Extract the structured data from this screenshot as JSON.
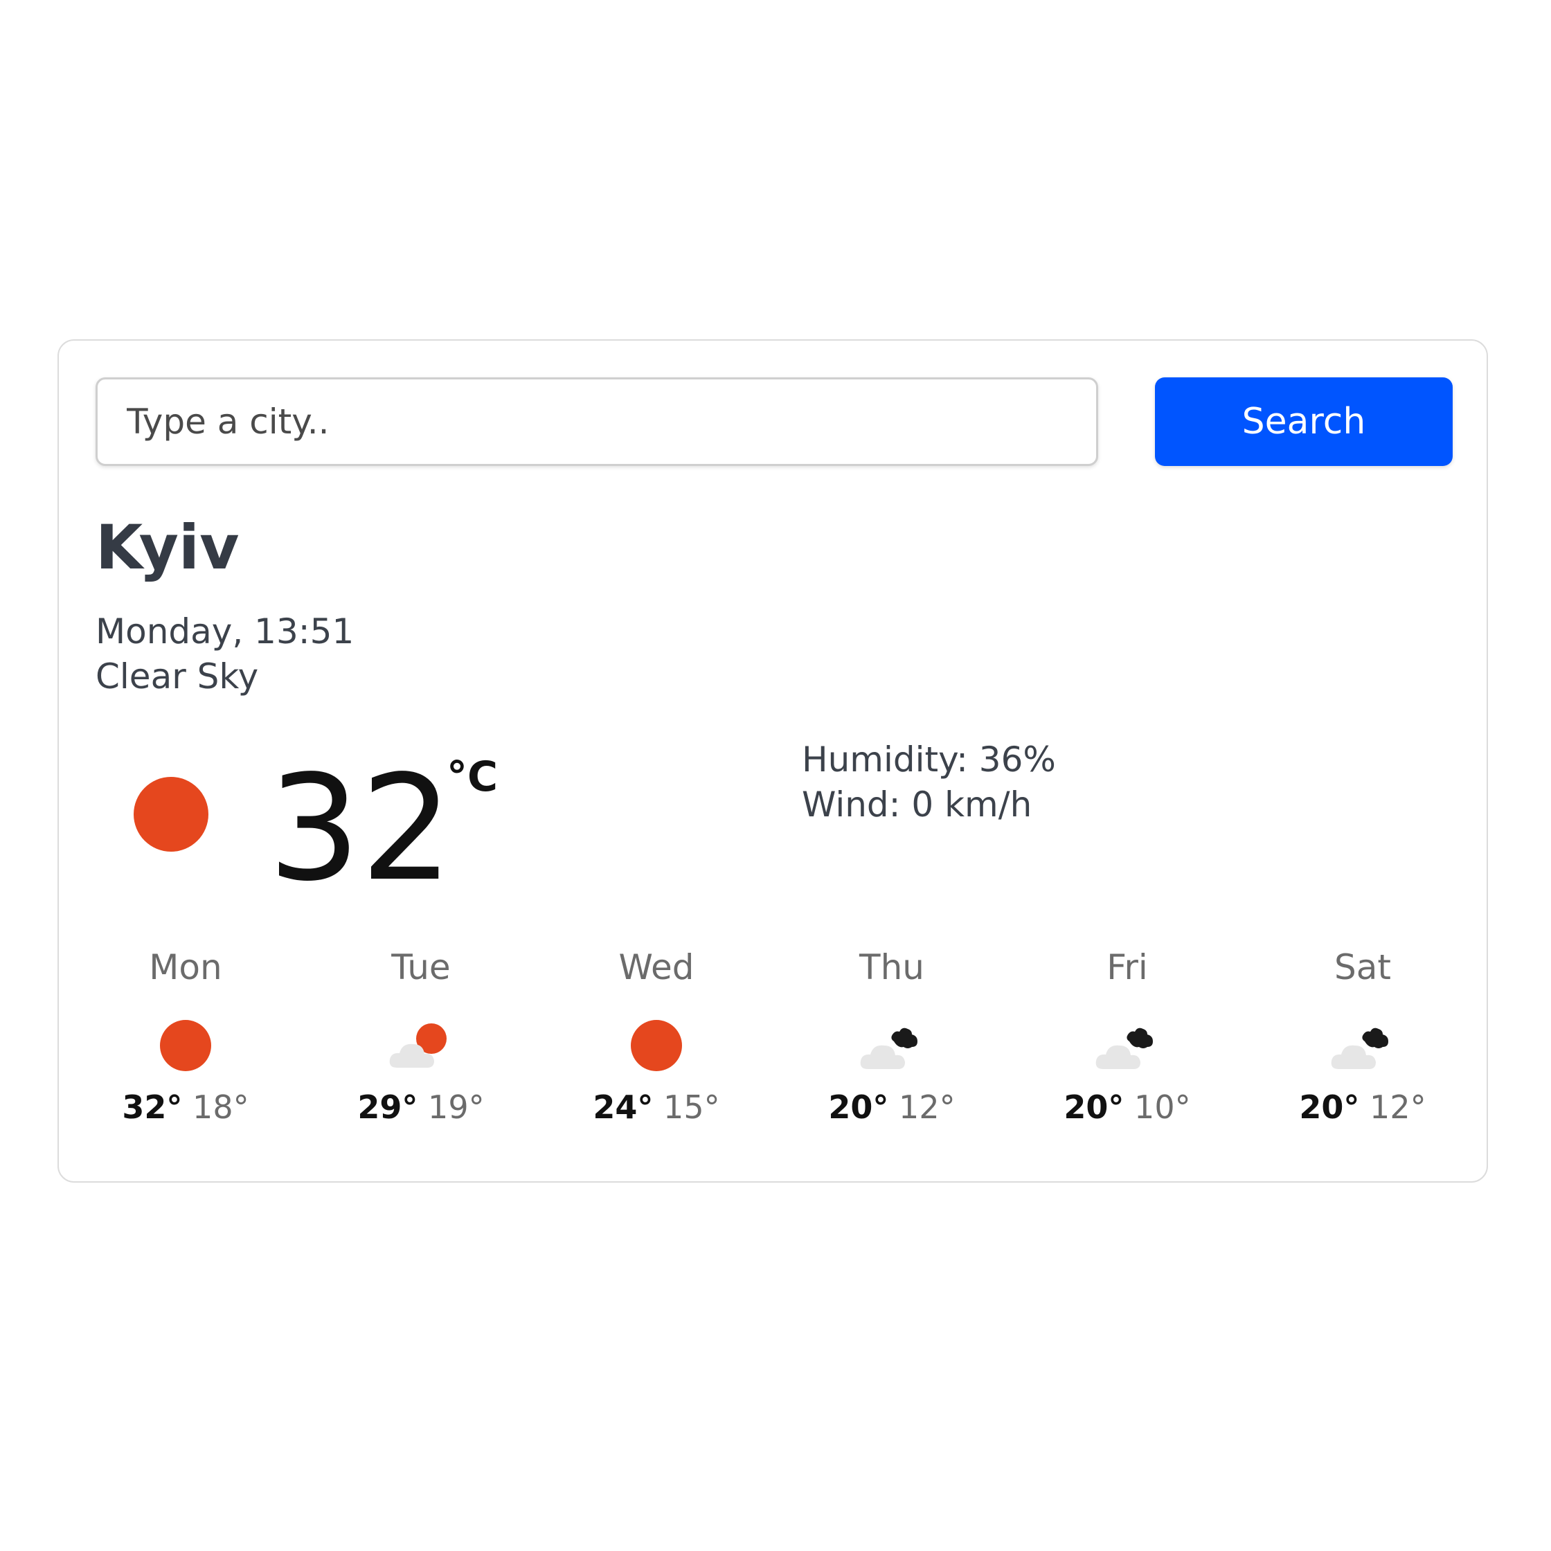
{
  "search": {
    "placeholder": "Type a city..",
    "button_label": "Search"
  },
  "current": {
    "city": "Kyiv",
    "datetime": "Monday, 13:51",
    "description": "Clear Sky",
    "temperature": "32",
    "unit": "°C",
    "icon": "sun-icon",
    "humidity": "Humidity: 36%",
    "wind": "Wind: 0 km/h"
  },
  "forecast": [
    {
      "day": "Mon",
      "icon": "sun-icon",
      "max": "32°",
      "min": "18°"
    },
    {
      "day": "Tue",
      "icon": "partly-sunny-icon",
      "max": "29°",
      "min": "19°"
    },
    {
      "day": "Wed",
      "icon": "sun-icon",
      "max": "24°",
      "min": "15°"
    },
    {
      "day": "Thu",
      "icon": "cloudy-icon",
      "max": "20°",
      "min": "12°"
    },
    {
      "day": "Fri",
      "icon": "cloudy-icon",
      "max": "20°",
      "min": "10°"
    },
    {
      "day": "Sat",
      "icon": "cloudy-icon",
      "max": "20°",
      "min": "12°"
    }
  ],
  "colors": {
    "accent": "#0055ff",
    "sun": "#e5471e",
    "cloud": "#e6e6e6",
    "dark_cloud": "#1a1a1a"
  }
}
